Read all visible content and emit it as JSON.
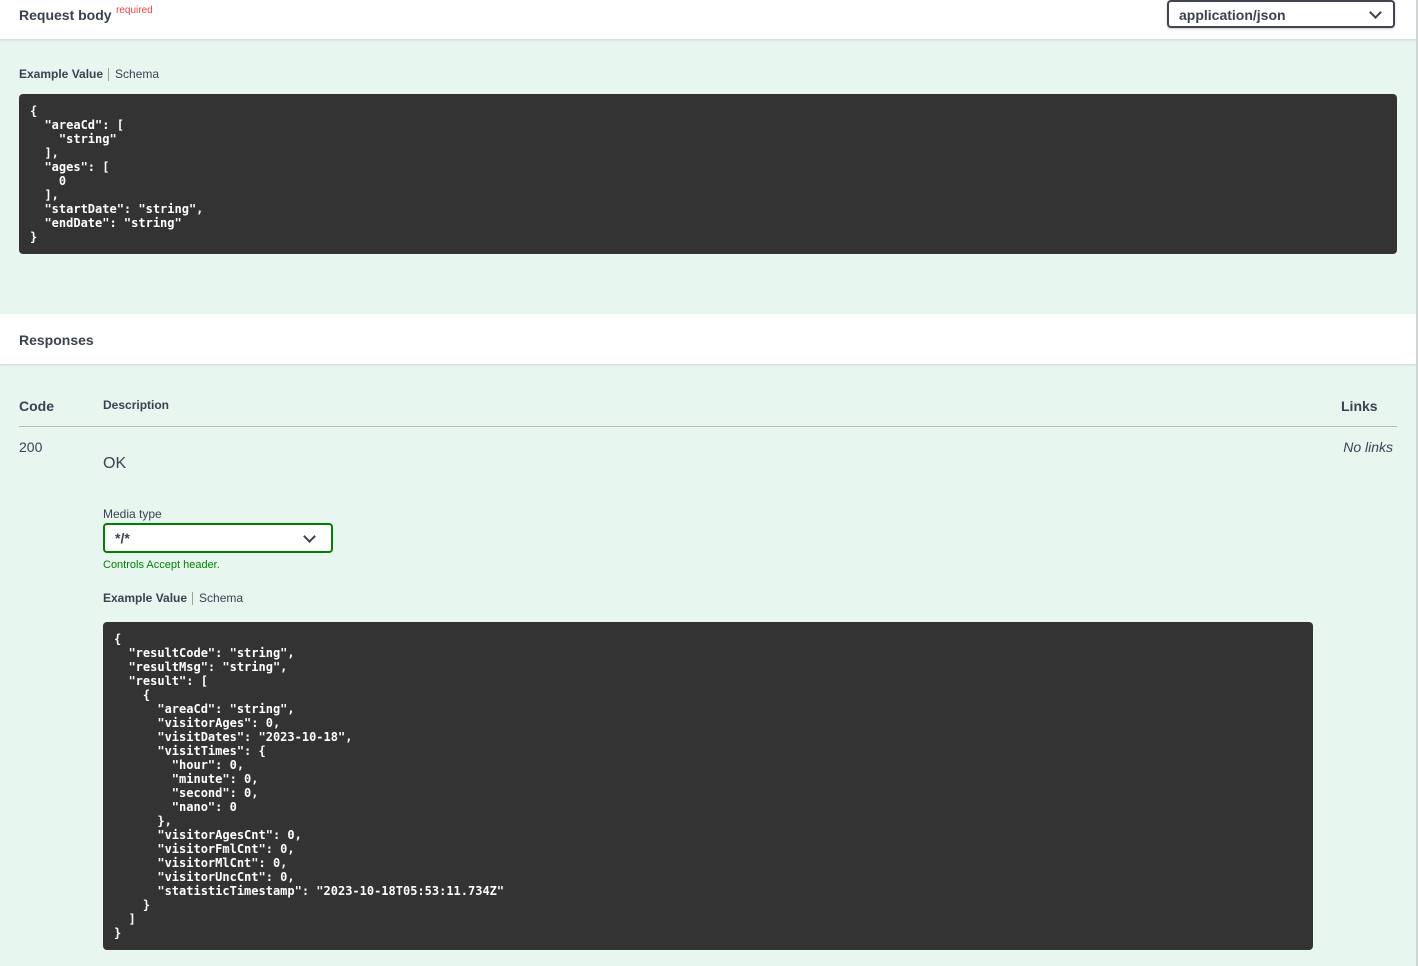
{
  "request_body": {
    "title": "Request body",
    "required": "required",
    "content_type": "application/json",
    "tabs": {
      "active": "Example Value",
      "inactive": "Schema"
    },
    "example": "{\n  \"areaCd\": [\n    \"string\"\n  ],\n  \"ages\": [\n    0\n  ],\n  \"startDate\": \"string\",\n  \"endDate\": \"string\"\n}"
  },
  "responses": {
    "title": "Responses",
    "columns": {
      "code": "Code",
      "description": "Description",
      "links": "Links"
    },
    "rows": [
      {
        "code": "200",
        "description": "OK",
        "links": "No links",
        "media_type_label": "Media type",
        "media_type_value": "*/*",
        "media_type_hint": "Controls Accept header.",
        "tabs": {
          "active": "Example Value",
          "inactive": "Schema"
        },
        "example": "{\n  \"resultCode\": \"string\",\n  \"resultMsg\": \"string\",\n  \"result\": [\n    {\n      \"areaCd\": \"string\",\n      \"visitorAges\": 0,\n      \"visitDates\": \"2023-10-18\",\n      \"visitTimes\": {\n        \"hour\": 0,\n        \"minute\": 0,\n        \"second\": 0,\n        \"nano\": 0\n      },\n      \"visitorAgesCnt\": 0,\n      \"visitorFmlCnt\": 0,\n      \"visitorMlCnt\": 0,\n      \"visitorUncCnt\": 0,\n      \"statisticTimestamp\": \"2023-10-18T05:53:11.734Z\"\n    }\n  ]\n}"
      }
    ]
  },
  "icons": {
    "content_type_dropdown": "chevron-down-icon",
    "media_type_dropdown": "chevron-down-icon"
  },
  "colors": {
    "background": "#e8f6f0",
    "code_background": "#333333",
    "required": "#f93e3e",
    "accent_green": "#008000"
  }
}
